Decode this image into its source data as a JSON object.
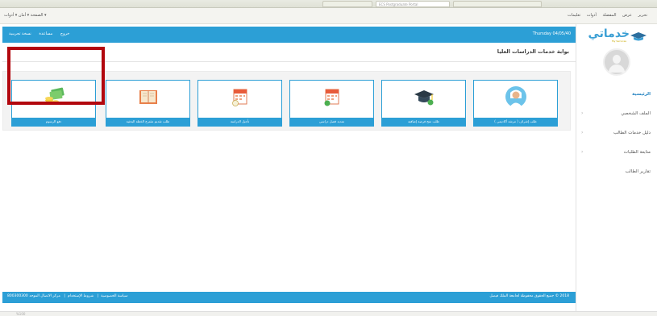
{
  "browser": {
    "tabs": [
      {
        "label": ""
      },
      {
        "label": "ECS Postgraduate Portal"
      },
      {
        "label": ""
      }
    ],
    "command_bar": "الصفحة ▾  أمان ▾  أدوات ▾",
    "menu": [
      "تحرير",
      "عرض",
      "المفضلة",
      "أدوات",
      "تعليمات"
    ],
    "status": "%100"
  },
  "header": {
    "date": "Thursday 04/05/40",
    "links": [
      "خروج",
      "مساعدة",
      "نسخة تجريبية"
    ]
  },
  "sidebar": {
    "logo_text": "خدماتي",
    "logo_sub": "My Services",
    "items": [
      {
        "label": "الرئيسية",
        "has_chevron": false
      },
      {
        "label": "الملف الشخصي",
        "has_chevron": true
      },
      {
        "label": "دليل خدمات الطالب",
        "has_chevron": true
      },
      {
        "label": "متابعة الطلبات",
        "has_chevron": true
      },
      {
        "label": "تقارير الطالب",
        "has_chevron": false
      }
    ]
  },
  "main": {
    "page_title": "بوابة خدمات الدراسات العليا",
    "cards": [
      {
        "label": "طلب إشراف ( مرشد أكاديمي )",
        "icon": "person-icon"
      },
      {
        "label": "طلب منح فرصة إضافية",
        "icon": "graduation-cap-icon"
      },
      {
        "label": "تمديد فصل دراسي",
        "icon": "calendar-plus-icon"
      },
      {
        "label": "تأجيل الدراسة",
        "icon": "calendar-clock-icon"
      },
      {
        "label": "طلب تقديم مقترح الخطة البحثية",
        "icon": "open-book-icon"
      },
      {
        "label": "دفع الرسوم",
        "icon": "money-coins-icon"
      }
    ]
  },
  "footer": {
    "copyright": "2018 © جميع الحقوق محفوظة لجامعة الملك فيصل",
    "links": [
      "سياسة الخصوصية",
      "شروط الإستخدام",
      "مركز الاتصال الموحد 800300300"
    ]
  },
  "colors": {
    "primary": "#2c9fd6",
    "highlight": "#b2070e",
    "card_bg": "#ffffff",
    "panel_bg": "#f3f3f3"
  }
}
